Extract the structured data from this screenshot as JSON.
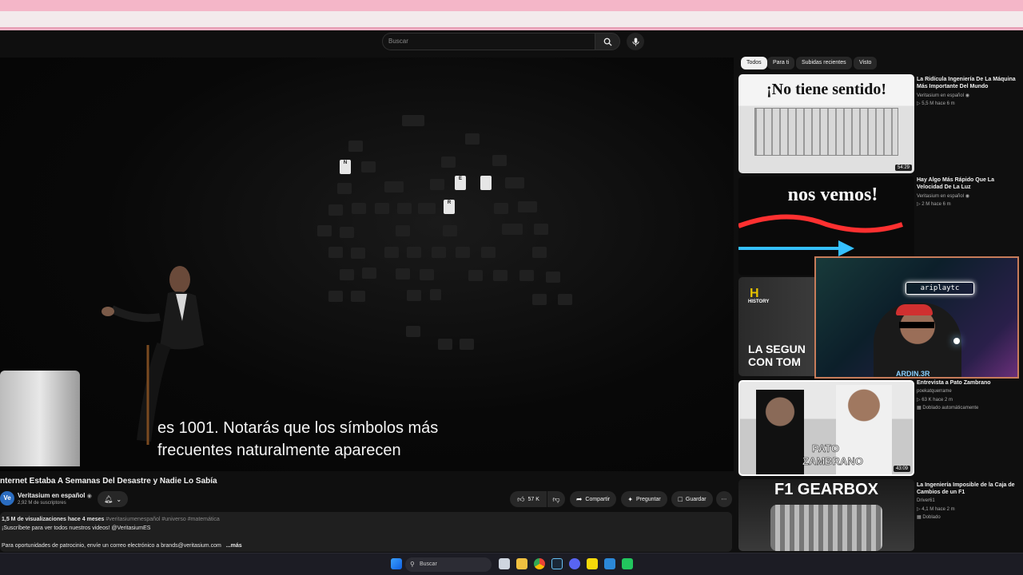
{
  "header": {
    "search_placeholder": "Buscar"
  },
  "player": {
    "subtitle_line1": "es 1001. Notarás que los símbolos más",
    "subtitle_line2": "frecuentes naturalmente aparecen"
  },
  "video": {
    "title": "nternet Estaba A Semanas Del Desastre y Nadie Lo Sabía",
    "channel_name": "Veritasium en español",
    "channel_avatar": "Ve",
    "subscribers": "2,92 M de suscriptores",
    "likes": "57 K",
    "share": "Compartir",
    "ask": "Preguntar",
    "save": "Guardar"
  },
  "description": {
    "stats": "1,5 M de visualizaciones  hace 4 meses",
    "hashtags": "#veritasiumenespañol #universo #matemática",
    "line2": "¡Suscríbete para ver todos nuestros videos! @VeritasiumES",
    "line3": "Para oportunidades de patrocinio, envíe un correo electrónico a brands@veritasium.com",
    "more": "...más"
  },
  "sidebar": {
    "chips": [
      "Todos",
      "Para ti",
      "Subidas recientes",
      "Visto"
    ],
    "videos": [
      {
        "thumb_text": "¡No tiene sentido!",
        "duration": "54:29",
        "title": "La Ridícula Ingeniería De La Máquina Más Importante Del Mundo",
        "channel": "Veritasium en español",
        "meta": "5,5 M  hace 6 m"
      },
      {
        "thumb_text": "nos vemos!",
        "duration": "",
        "title": "Hay Algo Más Rápido Que La Velocidad De La Luz",
        "channel": "Veritasium en español",
        "meta": "2 M  hace 6 m"
      },
      {
        "thumb_text_1": "LA SEGUN",
        "thumb_text_2": "CON TOM",
        "brand": "HISTORY"
      },
      {
        "thumb_text_1": "PATO",
        "thumb_text_2": "ZAMBRANO",
        "duration": "43:09",
        "title": "Entrevista a Pato Zambrano",
        "channel": "poekatquerrame",
        "meta": "63 K  hace 2 m",
        "badge": "Doblado automáticamente"
      },
      {
        "thumb_text": "F1 GEARBOX",
        "title": "La Ingeniería Imposible de la Caja de Cambios de un F1",
        "channel": "Driver61",
        "meta": "4,1 M  hace 2 m",
        "badge": "Doblado"
      }
    ]
  },
  "webcam": {
    "neon_sign": "ariplaytc",
    "shirt_text": "ARDIN.3R"
  },
  "taskbar": {
    "search_label": "Buscar"
  },
  "colors": {
    "background": "#0f0f0f",
    "browser_accent": "#f4b6c8",
    "webcam_border": "#c77c5a",
    "avatar_blue": "#2a6cc0"
  }
}
